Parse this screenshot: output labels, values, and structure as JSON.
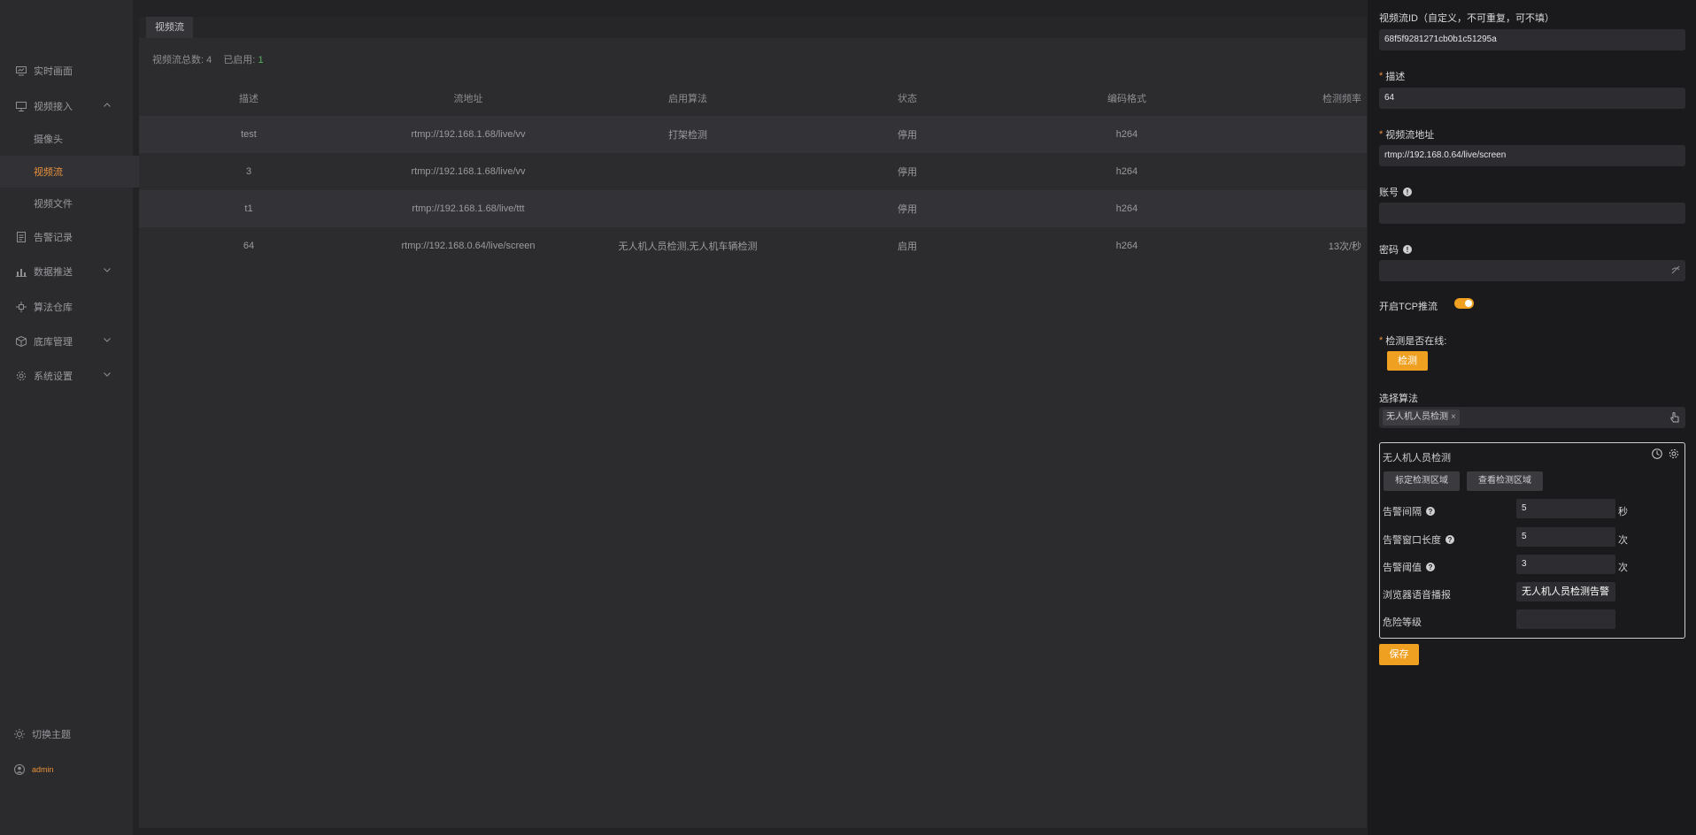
{
  "sidebar": {
    "items": [
      {
        "label": "实时画面",
        "icon": "monitor-icon"
      },
      {
        "label": "视频接入",
        "icon": "video-input-icon"
      },
      {
        "label": "摄像头"
      },
      {
        "label": "视频流"
      },
      {
        "label": "视频文件"
      },
      {
        "label": "告警记录",
        "icon": "document-icon"
      },
      {
        "label": "数据推送",
        "icon": "bar-chart-icon"
      },
      {
        "label": "算法仓库",
        "icon": "algorithm-icon"
      },
      {
        "label": "底库管理",
        "icon": "cube-icon"
      },
      {
        "label": "系统设置",
        "icon": "gear-icon"
      }
    ],
    "theme_toggle": "切换主题",
    "user": "admin"
  },
  "main": {
    "tab": "视频流",
    "summary": {
      "total_label": "视频流总数:",
      "total": "4",
      "enabled_label": "已启用:",
      "enabled": "1"
    },
    "columns": [
      "描述",
      "流地址",
      "启用算法",
      "状态",
      "编码格式",
      "检测频率"
    ],
    "rows": [
      [
        "test",
        "rtmp://192.168.1.68/live/vv",
        "打架检测",
        "停用",
        "h264",
        ""
      ],
      [
        "3",
        "rtmp://192.168.1.68/live/vv",
        "",
        "停用",
        "h264",
        ""
      ],
      [
        "t1",
        "rtmp://192.168.1.68/live/ttt",
        "",
        "停用",
        "h264",
        ""
      ],
      [
        "64",
        "rtmp://192.168.0.64/live/screen",
        "无人机人员检测,无人机车辆检测",
        "启用",
        "h264",
        "13次/秒"
      ]
    ]
  },
  "panel": {
    "stream_id": {
      "label": "视频流ID（自定义，不可重复，可不填）",
      "value": "68f5f9281271cb0b1c51295a"
    },
    "description": {
      "label": "描述",
      "value": "64"
    },
    "url": {
      "label": "视频流地址",
      "value": "rtmp://192.168.0.64/live/screen"
    },
    "account": {
      "label": "账号",
      "value": ""
    },
    "password": {
      "label": "密码",
      "value": ""
    },
    "tcp": {
      "label": "开启TCP推流",
      "on": true
    },
    "online_check": {
      "label": "检测是否在线:",
      "button": "检测"
    },
    "algorithms": {
      "label": "选择算法",
      "selected": [
        "无人机人员检测"
      ]
    },
    "algo_config": {
      "title": "无人机人员检测",
      "calibrate_button": "标定检测区域",
      "view_button": "查看检测区域",
      "alarm_interval": {
        "label": "告警间隔",
        "value": "5",
        "unit": "秒"
      },
      "alarm_window": {
        "label": "告警窗口长度",
        "value": "5",
        "unit": "次"
      },
      "alarm_threshold": {
        "label": "告警阈值",
        "value": "3",
        "unit": "次"
      },
      "voice_broadcast": {
        "label": "浏览器语音播报",
        "value": "无人机人员检测告警"
      },
      "danger_level": {
        "label": "危险等级",
        "value": ""
      }
    },
    "save_button": "保存"
  },
  "colors": {
    "accent": "#f0a020",
    "active_nav": "#e8913a",
    "enabled_count": "#56b35b"
  }
}
